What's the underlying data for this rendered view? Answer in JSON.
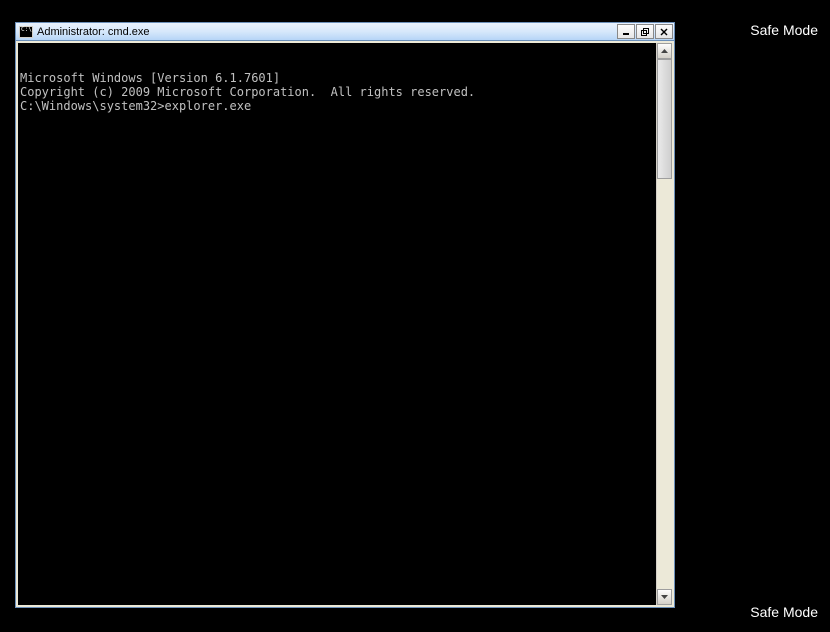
{
  "desktop": {
    "safe_mode_top": "Safe Mode",
    "safe_mode_bottom": "Safe Mode"
  },
  "window": {
    "title": "Administrator: cmd.exe",
    "buttons": {
      "minimize": "_",
      "maximize": "□",
      "close": "×"
    }
  },
  "console": {
    "line1": "Microsoft Windows [Version 6.1.7601]",
    "line2": "Copyright (c) 2009 Microsoft Corporation.  All rights reserved.",
    "line3": "",
    "prompt": "C:\\Windows\\system32>",
    "input": "explorer.exe"
  }
}
